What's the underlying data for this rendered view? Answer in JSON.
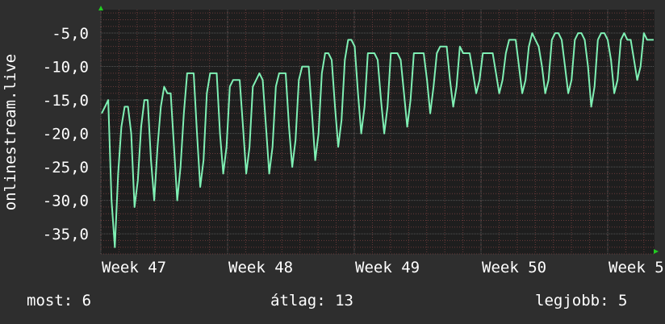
{
  "chart_data": {
    "type": "line",
    "ylabel": "onlinestream.live",
    "ylim": [
      -38,
      -1.5
    ],
    "yticks": [
      {
        "value": -5,
        "label": "-5,0"
      },
      {
        "value": -10,
        "label": "-10,0"
      },
      {
        "value": -15,
        "label": "-15,0"
      },
      {
        "value": -20,
        "label": "-20,0"
      },
      {
        "value": -25,
        "label": "-25,0"
      },
      {
        "value": -30,
        "label": "-30,0"
      },
      {
        "value": -35,
        "label": "-35,0"
      }
    ],
    "xticks": [
      "Week 47",
      "Week 48",
      "Week 49",
      "Week 50",
      "Week 5"
    ],
    "grid": true,
    "colors": {
      "line": "#7ff0b4",
      "background": "#1e1e1e",
      "grid_major": "#555555",
      "grid_minor": "#6a3a3a",
      "axis_arrow": "#22cc22"
    },
    "series": [
      {
        "values": [
          -17,
          -16,
          -15,
          -30,
          -37,
          -26,
          -19,
          -16,
          -16,
          -20,
          -31,
          -27,
          -19,
          -15,
          -15,
          -24,
          -30,
          -22,
          -16,
          -13,
          -14,
          -14,
          -22,
          -30,
          -25,
          -17,
          -11,
          -11,
          -11,
          -20,
          -28,
          -24,
          -14,
          -11,
          -11,
          -11,
          -20,
          -26,
          -22,
          -13,
          -12,
          -12,
          -12,
          -19,
          -26,
          -22,
          -13,
          -12,
          -11,
          -12,
          -19,
          -26,
          -22,
          -13,
          -11,
          -11,
          -11,
          -19,
          -25,
          -21,
          -12,
          -10,
          -10,
          -10,
          -17,
          -24,
          -20,
          -11,
          -8,
          -8,
          -9,
          -16,
          -22,
          -18,
          -9,
          -6,
          -6,
          -7,
          -14,
          -20,
          -16,
          -8,
          -8,
          -8,
          -9,
          -15,
          -20,
          -16,
          -8,
          -8,
          -8,
          -9,
          -14,
          -19,
          -15,
          -8,
          -8,
          -8,
          -8,
          -12,
          -17,
          -13,
          -8,
          -7,
          -7,
          -7,
          -12,
          -16,
          -13,
          -7,
          -8,
          -8,
          -8,
          -11,
          -14,
          -12,
          -8,
          -8,
          -8,
          -8,
          -11,
          -14,
          -12,
          -8,
          -6,
          -6,
          -6,
          -10,
          -14,
          -12,
          -7,
          -5,
          -6,
          -7,
          -10,
          -14,
          -12,
          -6,
          -5,
          -5,
          -6,
          -10,
          -14,
          -12,
          -6,
          -5,
          -5,
          -6,
          -10,
          -16,
          -13,
          -6,
          -5,
          -5,
          -6,
          -9,
          -14,
          -12,
          -6,
          -5,
          -6,
          -6,
          -9,
          -12,
          -10,
          -5,
          -6,
          -6,
          -6
        ]
      }
    ]
  },
  "footer": {
    "now": "most: 6",
    "avg": "átlag: 13",
    "best": "legjobb: 5"
  }
}
